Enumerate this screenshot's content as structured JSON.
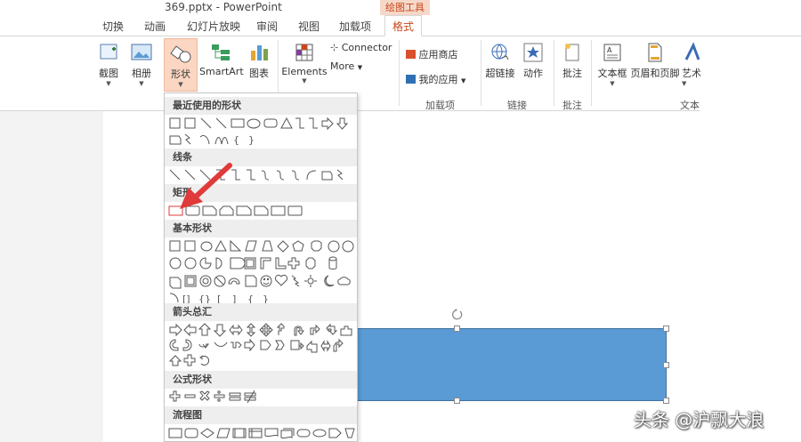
{
  "window": {
    "title": "369.pptx - PowerPoint",
    "contextual_tools": "绘图工具"
  },
  "tabs": [
    {
      "label": "切换"
    },
    {
      "label": "动画"
    },
    {
      "label": "幻灯片放映"
    },
    {
      "label": "审阅"
    },
    {
      "label": "视图"
    },
    {
      "label": "加载项"
    },
    {
      "label": "格式"
    }
  ],
  "ribbon": {
    "screenshot_label": "截图",
    "album_label": "相册",
    "shapes_label": "形状",
    "smartart_label": "SmartArt",
    "chart_label": "图表",
    "elements_label": "Elements",
    "connector_label": "Connector",
    "more_label": "More",
    "store_label": "应用商店",
    "myapps_label": "我的应用",
    "addins_group": "加载项",
    "hyperlink_label": "超链接",
    "action_label": "动作",
    "links_group": "链接",
    "comment_label": "批注",
    "comments_group": "批注",
    "textbox_label": "文本框",
    "header_footer_label": "页眉和页脚",
    "wordart_label": "艺术",
    "text_group": "文本"
  },
  "gallery": {
    "sections": [
      {
        "title": "最近使用的形状"
      },
      {
        "title": "线条"
      },
      {
        "title": "矩形"
      },
      {
        "title": "基本形状"
      },
      {
        "title": "箭头总汇"
      },
      {
        "title": "公式形状"
      },
      {
        "title": "流程图"
      }
    ]
  },
  "colors": {
    "accent": "#c8471c",
    "shape_fill": "#5b9bd5",
    "annotation_arrow": "#e03a3a"
  },
  "watermark": "头条 @沪飘大浪"
}
